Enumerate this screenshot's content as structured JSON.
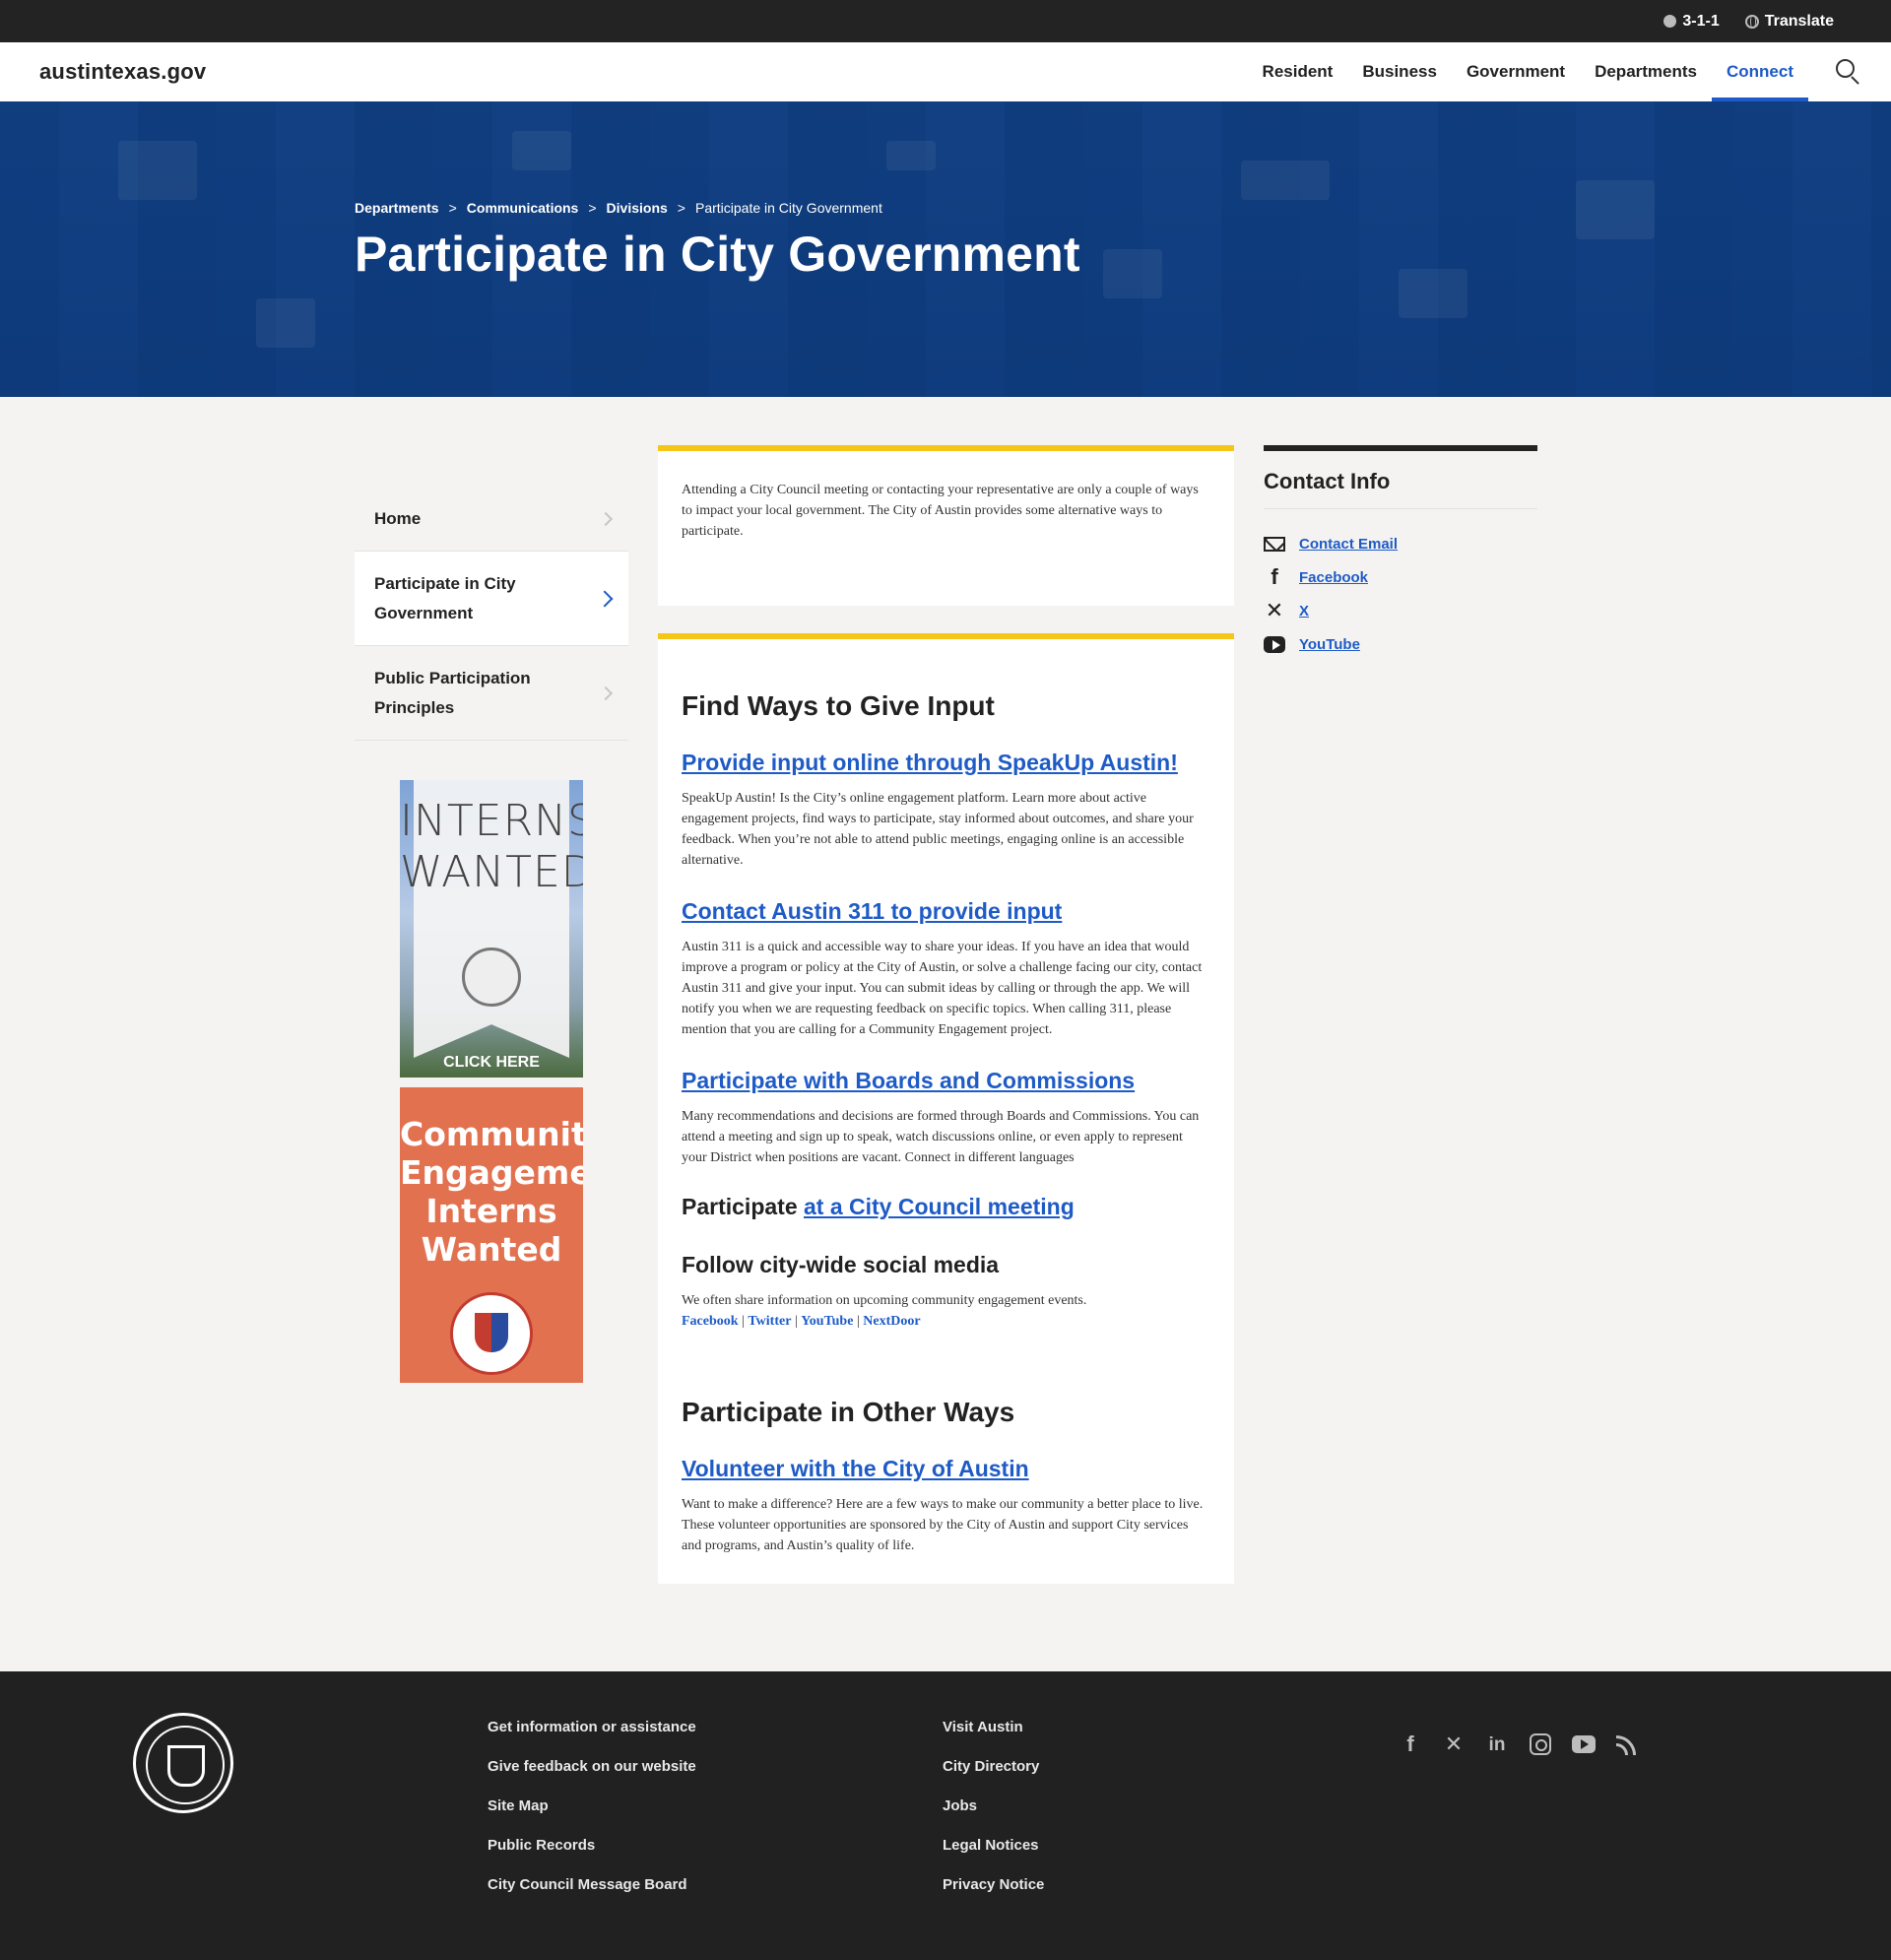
{
  "utility": {
    "phone": "3-1-1",
    "translate": "Translate"
  },
  "nav": {
    "logo": "austintexas.gov",
    "links": [
      "Resident",
      "Business",
      "Government",
      "Departments",
      "Connect"
    ],
    "active": "Connect",
    "search_icon": "search-icon"
  },
  "hero": {
    "breadcrumb": [
      "Departments",
      "Communications",
      "Divisions"
    ],
    "breadcrumb_separator": ">",
    "current": "Participate in City Government",
    "title": "Participate in City Government"
  },
  "sidebar": {
    "items": [
      "Home",
      "Participate in City Government",
      "Public Participation Principles"
    ],
    "active_index": 1
  },
  "promos": {
    "interns_line1": "INTERNS",
    "interns_line2": "WANTED",
    "interns_cta": "CLICK HERE",
    "community_line1": "Community",
    "community_line2": "Engagement",
    "community_line3": "Interns",
    "community_line4": "Wanted"
  },
  "intro": {
    "text": "Attending a City Council meeting or contacting your representative are only a couple of ways to impact your local government. The City of Austin provides some alternative ways to participate."
  },
  "main": {
    "heading1": "Find Ways to Give Input",
    "speakup_title": "Provide input online through SpeakUp Austin!",
    "speakup_text": "SpeakUp Austin! Is the City’s online engagement platform. Learn more about active engagement projects, find ways to participate, stay informed about outcomes, and share your feedback. When you’re not able to attend public meetings, engaging online is an accessible alternative.",
    "austin311_title": "Contact Austin 311 to provide input",
    "austin311_text": "Austin 311 is a quick and accessible way to share your ideas. If you have an idea that would improve a program or policy at the City of Austin, or solve a challenge facing our city, contact Austin 311 and give your input. You can submit ideas by calling or through the app. We will notify you when we are requesting feedback on specific topics. When calling 311, please mention that you are calling for a Community Engagement project.",
    "boards_title": "Participate with Boards and Commissions",
    "boards_text": "Many recommendations and decisions are formed through Boards and Commissions. You can attend a meeting and sign up to speak, watch discussions online, or even apply to represent your District when positions are vacant. Connect in different languages",
    "council_prefix": "Participate",
    "council_link": "at a City Council meeting",
    "social_title": "Follow city-wide social media",
    "social_text": "We often share information on upcoming community engagement events.",
    "social_links": [
      "Facebook",
      "Twitter",
      "YouTube",
      "NextDoor"
    ],
    "social_separator": "|",
    "heading2": "Participate in Other Ways",
    "volunteer_title": "Volunteer with the City of Austin",
    "volunteer_text": "Want to make a difference? Here are a few ways to make our community a better place to live. These volunteer opportunities are sponsored by the City of Austin and support City services and programs, and Austin’s quality of life."
  },
  "contact": {
    "title": "Contact Info",
    "items": [
      "Contact Email",
      "Facebook",
      "X",
      "YouTube"
    ],
    "icons": [
      "mail-icon",
      "facebook-icon",
      "x-icon",
      "youtube-icon"
    ]
  },
  "footer": {
    "col1": [
      "Get information or assistance",
      "Give feedback on our website",
      "Site Map",
      "Public Records",
      "City Council Message Board"
    ],
    "col2": [
      "Visit Austin",
      "City Directory",
      "Jobs",
      "Legal Notices",
      "Privacy Notice"
    ],
    "social_icons": [
      "facebook-icon",
      "x-icon",
      "linkedin-icon",
      "instagram-icon",
      "youtube-icon",
      "rss-icon"
    ]
  }
}
